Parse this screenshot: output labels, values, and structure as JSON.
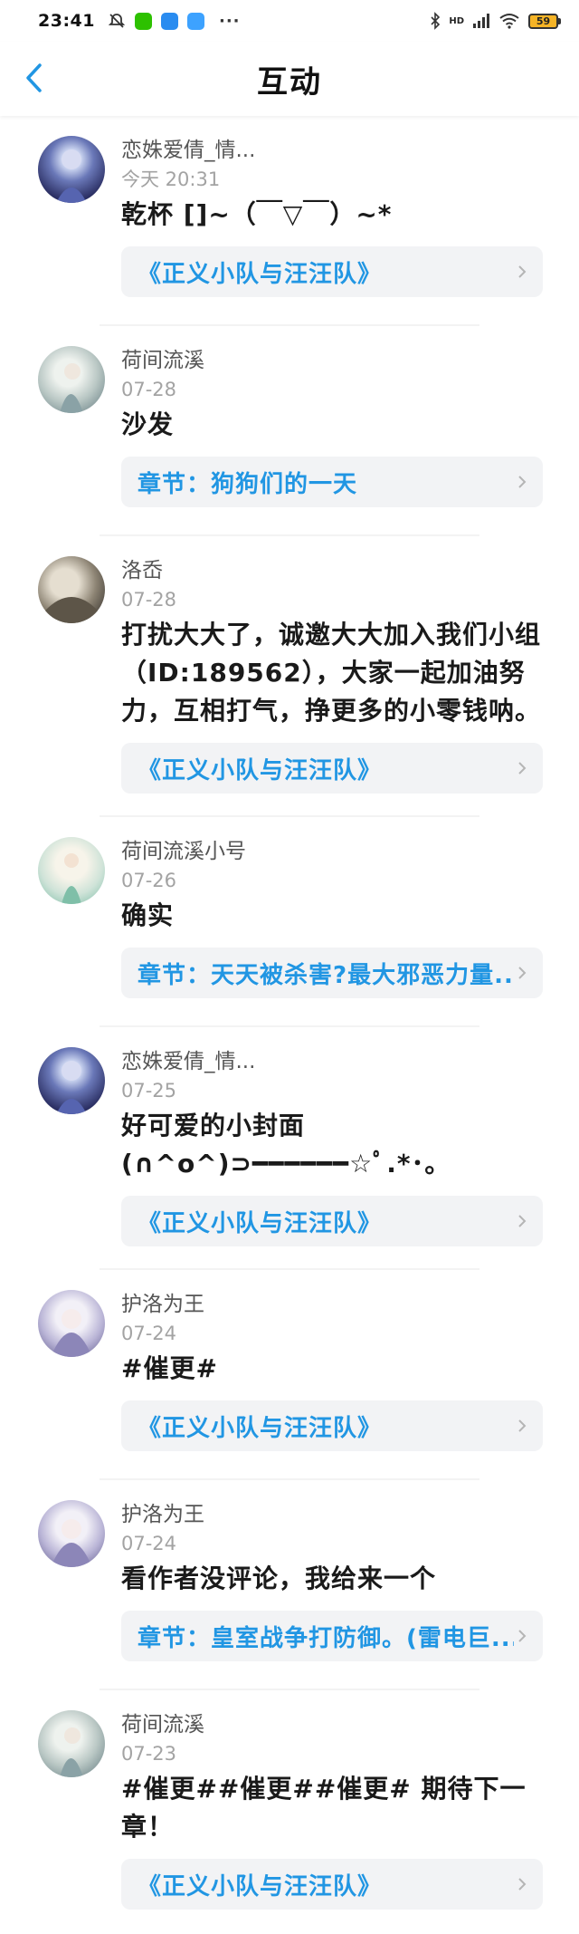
{
  "status_bar": {
    "time": "23:41",
    "icons_left": [
      "mute-icon",
      "wechat-icon",
      "cloud-icon",
      "app-icon"
    ],
    "dots": "···",
    "icons_right": [
      "bluetooth-icon",
      "signal-icon",
      "wifi-icon"
    ],
    "network": "HD",
    "battery": "59",
    "colors": {
      "wechat": "#2dc100",
      "cloud": "#2a8cf0",
      "app": "#3da2ff",
      "battery": "#f6b426"
    }
  },
  "header": {
    "title": "互动",
    "back_icon": "chevron-left-icon",
    "accent_color": "#2196e3"
  },
  "comments": [
    {
      "username": "恋姝爱倩_情...",
      "date": "今天 20:31",
      "text": "乾杯 []~（￣▽￣）~*",
      "link": "《正义小队与汪汪队》"
    },
    {
      "username": "荷间流溪",
      "date": "07-28",
      "text": "沙发",
      "link": "章节：狗狗们的一天"
    },
    {
      "username": "洛岙",
      "date": "07-28",
      "text": "打扰大大了，诚邀大大加入我们小组（ID:189562），大家一起加油努力，互相打气，挣更多的小零钱呐。",
      "link": "《正义小队与汪汪队》"
    },
    {
      "username": "荷间流溪小号",
      "date": "07-26",
      "text": "确实",
      "link": "章节：天天被杀害?最大邪恶力量..."
    },
    {
      "username": "恋姝爱倩_情...",
      "date": "07-25",
      "text": "好可爱的小封面(∩^o^)⊃━━━━━━☆ﾟ.*･｡",
      "link": "《正义小队与汪汪队》"
    },
    {
      "username": "护洛为王",
      "date": "07-24",
      "text": "#催更#",
      "link": "《正义小队与汪汪队》"
    },
    {
      "username": "护洛为王",
      "date": "07-24",
      "text": "看作者没评论，我给来一个",
      "link": "章节：皇室战争打防御。(雷电巨..."
    },
    {
      "username": "荷间流溪",
      "date": "07-23",
      "text": "#催更##催更##催更# 期待下一章！",
      "link": "《正义小队与汪汪队》"
    }
  ]
}
